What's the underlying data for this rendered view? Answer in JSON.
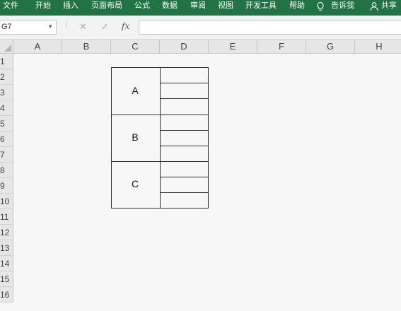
{
  "ribbon": {
    "tabs": [
      "文件",
      "开始",
      "插入",
      "页面布局",
      "公式",
      "数据",
      "审阅",
      "视图",
      "开发工具",
      "帮助"
    ],
    "tell_me": "告诉我",
    "share": "共享"
  },
  "formula_bar": {
    "name_box": "G7",
    "formula": ""
  },
  "grid": {
    "columns": [
      "A",
      "B",
      "C",
      "D",
      "E",
      "F",
      "G",
      "H"
    ],
    "rows": [
      "1",
      "2",
      "3",
      "4",
      "5",
      "6",
      "7",
      "8",
      "9",
      "10",
      "11",
      "12",
      "13",
      "14",
      "15",
      "16"
    ]
  },
  "table": {
    "groups": [
      "A",
      "B",
      "C"
    ]
  },
  "colors": {
    "ribbon": "#217346",
    "header_bg": "#e6e6e6",
    "sheet_bg": "#f7f7f7"
  }
}
